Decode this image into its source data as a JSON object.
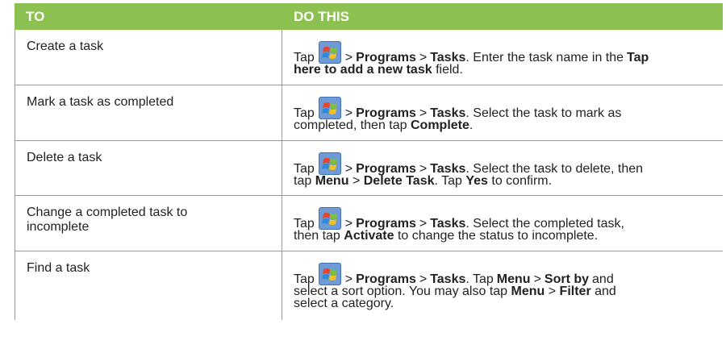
{
  "header": {
    "col1": "TO",
    "col2": "DO THIS"
  },
  "rows": [
    {
      "task": "Create a task",
      "t": [
        "Tap",
        ">",
        "Programs",
        ">",
        "Tasks",
        ". Enter the task name in the",
        "Tap",
        "here to add a new task",
        "field."
      ]
    },
    {
      "task": "Mark a task as completed",
      "t": [
        "Tap",
        ">",
        "Programs",
        ">",
        "Tasks",
        ". Select the task to mark as",
        "completed, then tap",
        "Complete",
        "."
      ]
    },
    {
      "task": "Delete a task",
      "t": [
        "Tap",
        ">",
        "Programs",
        ">",
        "Tasks",
        ". Select the task to delete, then",
        "tap",
        "Menu",
        ">",
        "Delete Task",
        ". Tap",
        "Yes",
        "to confirm."
      ]
    },
    {
      "task": "Change a completed task to incomplete",
      "t": [
        "Tap",
        ">",
        "Programs",
        ">",
        "Tasks",
        ". Select the completed task,",
        "then tap",
        "Activate",
        "to change the status to incomplete."
      ]
    },
    {
      "task": "Find a task",
      "t": [
        "Tap",
        ">",
        "Programs",
        ">",
        "Tasks",
        ". Tap",
        "Menu",
        ">",
        "Sort by",
        "and",
        "select a sort option. You may also tap",
        "Menu",
        ">",
        "Filter",
        "and",
        "select a category."
      ]
    }
  ],
  "icons": {
    "start": "windows-start-icon"
  },
  "colors": {
    "header_bg": "#8cc152",
    "header_text": "#ffffff",
    "border": "#9a9a9a"
  }
}
